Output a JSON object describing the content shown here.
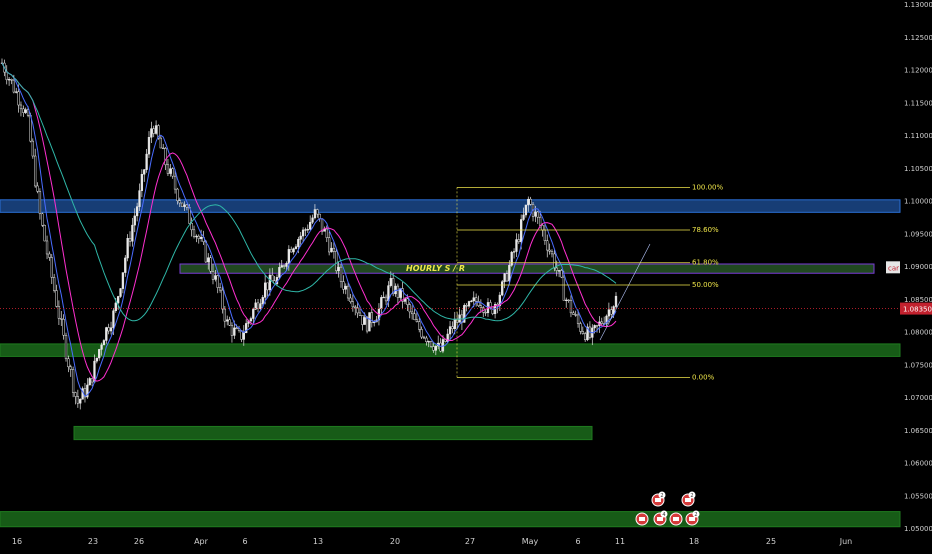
{
  "colors": {
    "background": "#000000",
    "candle": "#e8e8e8",
    "ma_fast": "#4a6cff",
    "ma_mid": "#ff2fd0",
    "ma_slow": "#2fb7a8",
    "zone_green": "#1f7a1f",
    "zone_blue": "#2a6fd6",
    "zone_purple": "#7a3cd6",
    "fib": "#f0e64a",
    "current_price": "#c2212e"
  },
  "price_axis": {
    "labels": [
      "1.13000",
      "1.12500",
      "1.12000",
      "1.11500",
      "1.11000",
      "1.10500",
      "1.10000",
      "1.09500",
      "1.09000",
      "1.08500",
      "1.08000",
      "1.07500",
      "1.07000",
      "1.06500",
      "1.06000",
      "1.05500",
      "1.05000"
    ],
    "current_price": "1.08350",
    "symbol_tag": "car"
  },
  "time_axis": {
    "labels": [
      "16",
      "23",
      "26",
      "Apr",
      "6",
      "13",
      "20",
      "27",
      "May",
      "6",
      "11",
      "18",
      "25",
      "Jun"
    ]
  },
  "zone_label": "HOURLY S / R",
  "fib_levels": [
    "100.00%",
    "78.60%",
    "61.80%",
    "50.00%",
    "0.00%"
  ],
  "event_icons": {
    "top_counts": [
      "2",
      "2"
    ],
    "bottom_counts": [
      "4",
      "2"
    ]
  },
  "chart_data": {
    "type": "candlestick",
    "ylim": [
      1.05,
      1.13
    ],
    "x_labels": [
      "16",
      "23",
      "26",
      "Apr",
      "6",
      "13",
      "20",
      "27",
      "May",
      "6",
      "11",
      "18",
      "25",
      "Jun"
    ],
    "close_path": [
      1.121,
      1.117,
      1.113,
      1.098,
      1.088,
      1.078,
      1.069,
      1.072,
      1.079,
      1.083,
      1.093,
      1.101,
      1.112,
      1.106,
      1.101,
      1.097,
      1.093,
      1.088,
      1.081,
      1.079,
      1.083,
      1.087,
      1.088,
      1.093,
      1.095,
      1.098,
      1.094,
      1.088,
      1.085,
      1.081,
      1.083,
      1.087,
      1.085,
      1.081,
      1.079,
      1.077,
      1.081,
      1.083,
      1.085,
      1.083,
      1.087,
      1.093,
      1.1,
      1.096,
      1.091,
      1.085,
      1.081,
      1.079,
      1.082,
      1.085
    ],
    "zones": [
      {
        "kind": "support",
        "low": 1.0765,
        "high": 1.0778
      },
      {
        "kind": "support",
        "low": 1.0638,
        "high": 1.0652
      },
      {
        "kind": "support",
        "low": 1.0505,
        "high": 1.0522
      },
      {
        "kind": "resistance",
        "low": 1.0985,
        "high": 1.0998
      },
      {
        "kind": "hourly_sr",
        "low": 1.0892,
        "high": 1.09
      }
    ],
    "fib": [
      {
        "label": "100.00%",
        "price": 1.102
      },
      {
        "label": "78.60%",
        "price": 1.0955
      },
      {
        "label": "61.80%",
        "price": 1.0905
      },
      {
        "label": "50.00%",
        "price": 1.0871
      },
      {
        "label": "0.00%",
        "price": 1.073
      }
    ]
  }
}
